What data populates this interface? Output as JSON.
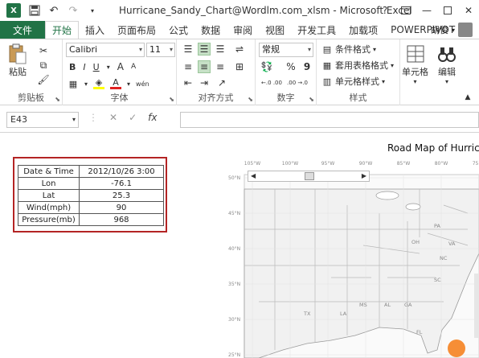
{
  "titlebar": {
    "logo": "X",
    "title": "Hurricane_Sandy_Chart@Wordlm.com_xlsm - Microsoft Excel",
    "icons": [
      "excel-logo",
      "save-icon",
      "undo-icon",
      "redo-icon",
      "customize-icon",
      "help-icon",
      "restore-icon",
      "minimize-icon",
      "maximize-icon",
      "close-icon"
    ]
  },
  "tabs": {
    "file": "文件",
    "items": [
      "开始",
      "插入",
      "页面布局",
      "公式",
      "数据",
      "审阅",
      "视图",
      "开发工具",
      "加载项",
      "POWERPIVOT"
    ],
    "active": "开始",
    "user": "胡俊"
  },
  "ribbon": {
    "clipboard": {
      "paste": "粘贴",
      "label": "剪贴板"
    },
    "font": {
      "name": "Calibri",
      "size": "11",
      "bold": "B",
      "italic": "I",
      "underline": "U",
      "grow": "A",
      "shrink": "A",
      "fontcolor": "A",
      "phonetic": "wén",
      "label": "字体"
    },
    "alignment": {
      "label": "对齐方式"
    },
    "number": {
      "format": "常规",
      "percent": "%",
      "comma": "9",
      "inc_decimal": "←.0 .00",
      "dec_decimal": ".00 →.0",
      "label": "数字"
    },
    "styles": {
      "conditional": "条件格式",
      "table": "套用表格格式",
      "cell": "单元格样式",
      "label": "样式"
    },
    "cells": {
      "button": "单元格"
    },
    "editing": {
      "button": "编辑"
    }
  },
  "formula_bar": {
    "name_box": "E43",
    "cancel": "✕",
    "enter": "✓",
    "fx": "fx",
    "value": ""
  },
  "data_table": [
    {
      "label": "Date & Time",
      "value": "2012/10/26 3:00"
    },
    {
      "label": "Lon",
      "value": "-76.1"
    },
    {
      "label": "Lat",
      "value": "25.3"
    },
    {
      "label": "Wind(mph)",
      "value": "90"
    },
    {
      "label": "Pressure(mb)",
      "value": "968"
    }
  ],
  "chart": {
    "title": "Road Map of Hurric",
    "lon_ticks": [
      "105°W",
      "100°W",
      "95°W",
      "90°W",
      "85°W",
      "80°W",
      "75°W"
    ],
    "lat_ticks": [
      "50°N",
      "45°N",
      "40°N",
      "35°N",
      "30°N",
      "25°N"
    ],
    "state_labels": [
      "TX",
      "LA",
      "MS",
      "AL",
      "GA",
      "SC",
      "NC",
      "VA",
      "OH",
      "PA",
      "FL"
    ],
    "marker_color": "#f58220"
  },
  "colors": {
    "accent": "#217346",
    "highlight_border": "#b42424"
  }
}
